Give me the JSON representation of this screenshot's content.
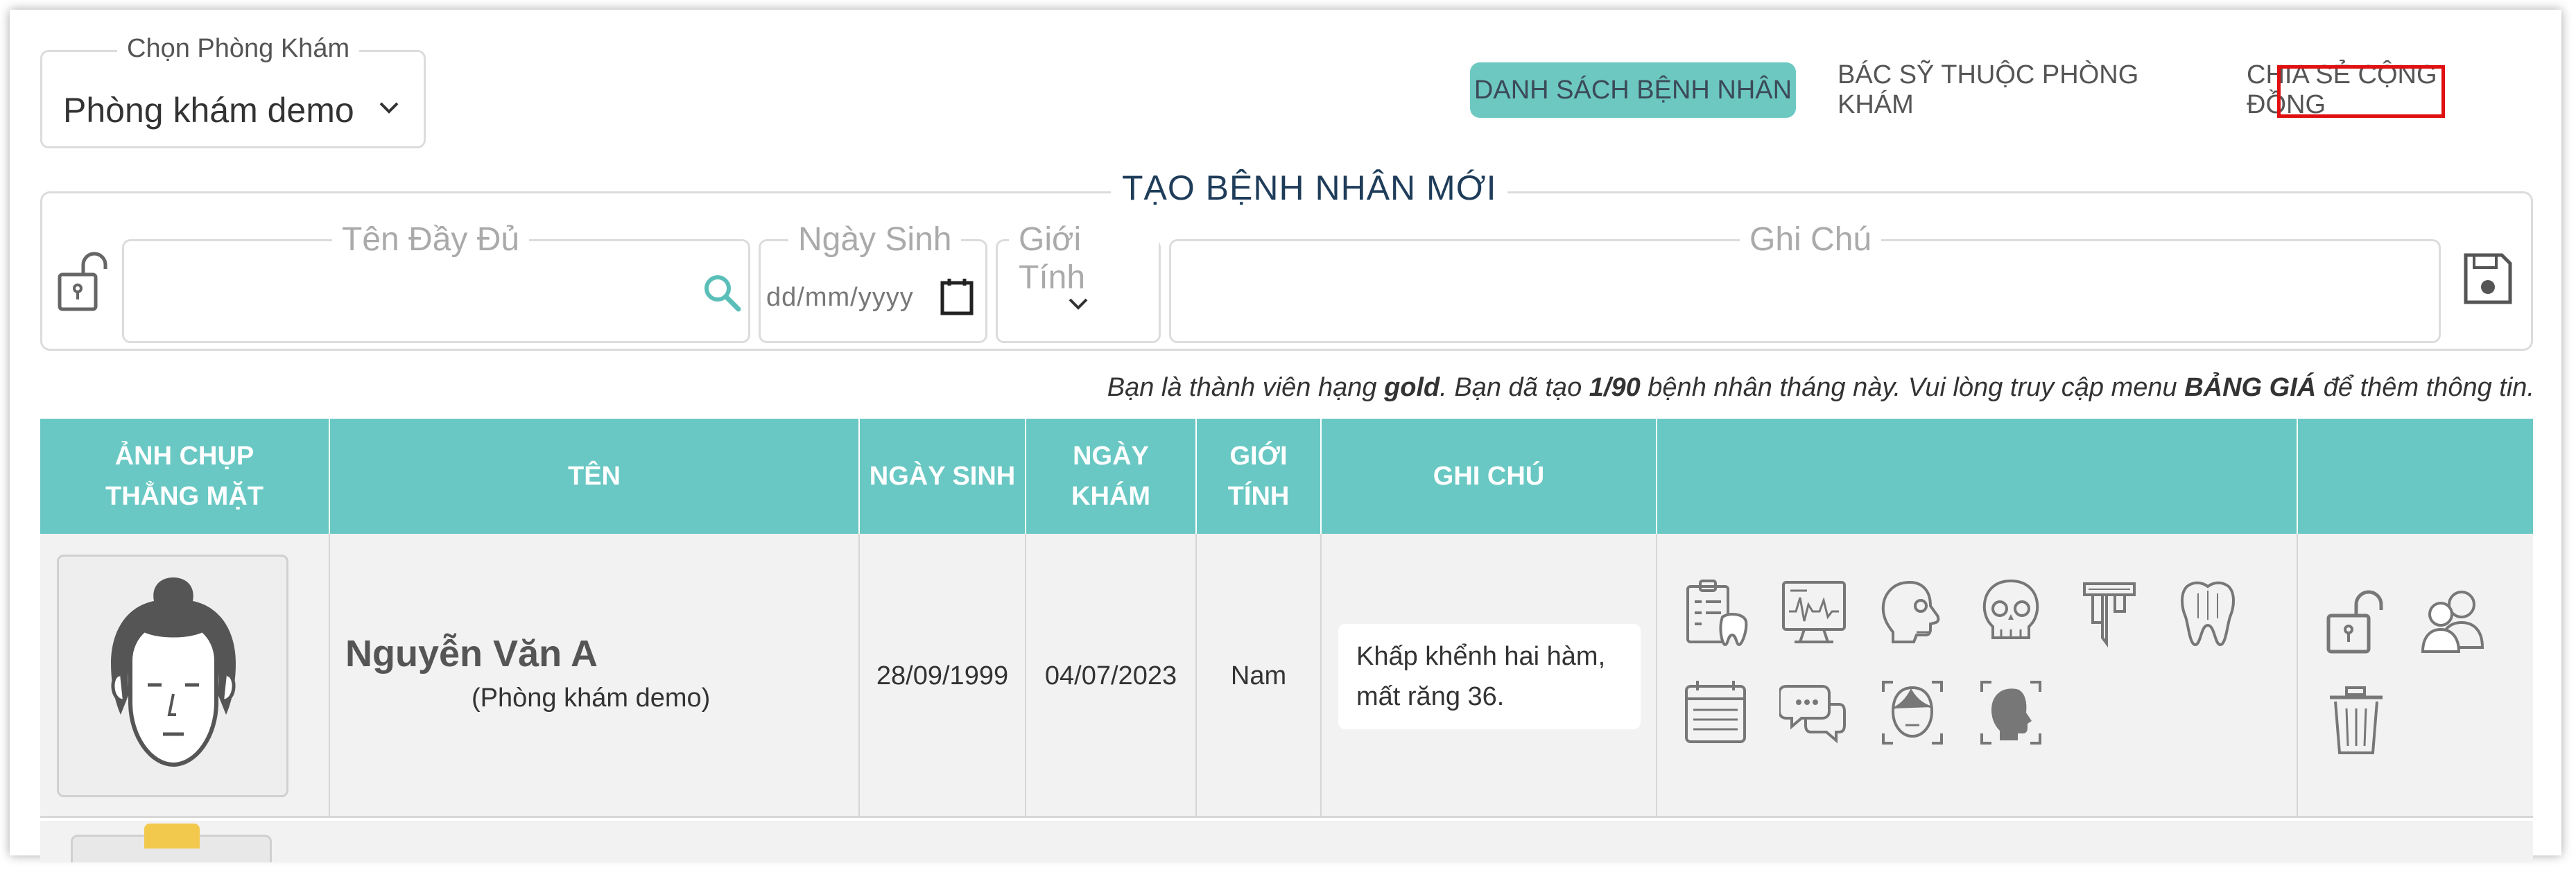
{
  "clinic_select": {
    "legend": "Chọn Phòng Khám",
    "value": "Phòng khám demo"
  },
  "nav": {
    "patients": "DANH SÁCH BỆNH NHÂN",
    "doctors": "BÁC SỸ THUỘC PHÒNG KHÁM",
    "share": "CHIA SẺ CỘNG ĐỒNG"
  },
  "create": {
    "title": "TẠO BỆNH NHÂN MỚI",
    "name_legend": "Tên Đầy Đủ",
    "birth_legend": "Ngày Sinh",
    "birth_placeholder": "dd/mm/yyyy",
    "gender_legend": "Giới Tính",
    "note_legend": "Ghi Chú"
  },
  "notice": {
    "part1": "Bạn là thành viên hạng ",
    "tier": "gold",
    "part2": ".  Bạn dã tạo ",
    "count": "1/90",
    "part3": " bệnh nhân tháng này.  Vui lòng truy cập menu ",
    "menu": "BẢNG GIÁ",
    "part4": " để thêm thông tin."
  },
  "table": {
    "headers": [
      "ẢNH CHỤP THẲNG MẶT",
      "TÊN",
      "NGÀY SINH",
      "NGÀY KHÁM",
      "GIỚI TÍNH",
      "GHI CHÚ",
      "",
      ""
    ],
    "rows": [
      {
        "name": "Nguyễn Văn A",
        "clinic": "(Phòng khám demo)",
        "birth": "28/09/1999",
        "visit": "04/07/2023",
        "gender": "Nam",
        "note": "Khấp khểnh hai hàm, mất răng 36."
      }
    ]
  },
  "icons": {
    "tools": [
      "dental-chart-icon",
      "xray-monitor-icon",
      "skull-side-icon",
      "skull-front-icon",
      "caliper-icon",
      "tooth-icon",
      "calendar-icon",
      "chat-icon",
      "face-scan-icon",
      "profile-scan-icon"
    ],
    "actions": [
      "unlock-icon",
      "share-users-icon",
      "trash-icon"
    ]
  },
  "colors": {
    "accent": "#69c8c3",
    "highlight": "#e01010"
  }
}
